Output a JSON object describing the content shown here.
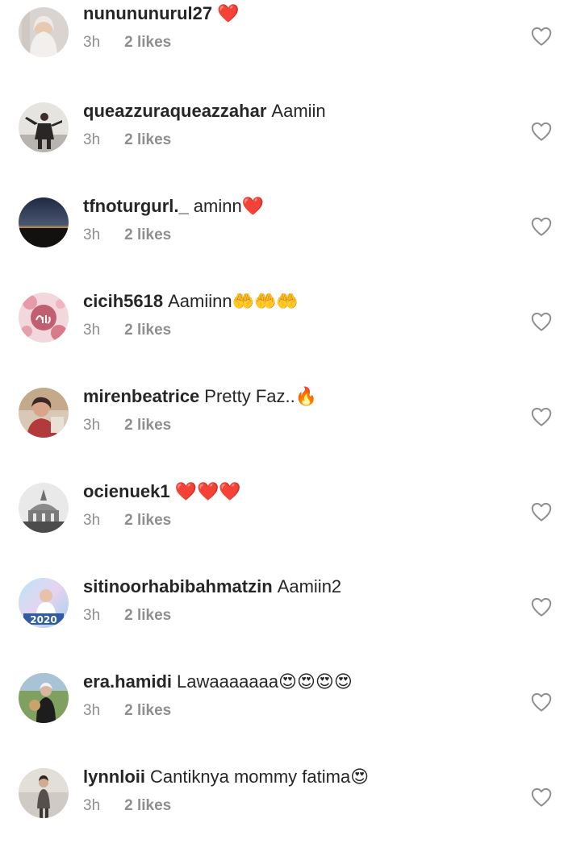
{
  "comments": [
    {
      "username": "nunununurul27",
      "text": "❤️",
      "time": "3h",
      "likes": "2 likes"
    },
    {
      "username": "queazzuraqueazzahar",
      "text": "Aamiin",
      "time": "3h",
      "likes": "2 likes"
    },
    {
      "username": "tfnoturgurl._",
      "text": "aminn❤️",
      "time": "3h",
      "likes": "2 likes"
    },
    {
      "username": "cicih5618",
      "text": "Aamiinn🤲🤲🤲",
      "time": "3h",
      "likes": "2 likes"
    },
    {
      "username": "mirenbeatrice",
      "text": "Pretty Faz..🔥",
      "time": "3h",
      "likes": "2 likes"
    },
    {
      "username": "ocienuek1",
      "text": "❤️❤️❤️",
      "time": "3h",
      "likes": "2 likes"
    },
    {
      "username": "sitinoorhabibahmatzin",
      "text": "Aamiin2",
      "time": "3h",
      "likes": "2 likes"
    },
    {
      "username": "era.hamidi",
      "text": "Lawaaaaaaa😍😍😍😍",
      "time": "3h",
      "likes": "2 likes"
    },
    {
      "username": "lynnloii",
      "text": "Cantiknya mommy fatima😍",
      "time": "3h",
      "likes": "2 likes"
    }
  ],
  "avatar_badge_text": "2020",
  "colors": {
    "text": "#262626",
    "secondary": "#8e8e8e",
    "background": "#ffffff"
  },
  "icons": {
    "like": "heart-outline-icon"
  }
}
